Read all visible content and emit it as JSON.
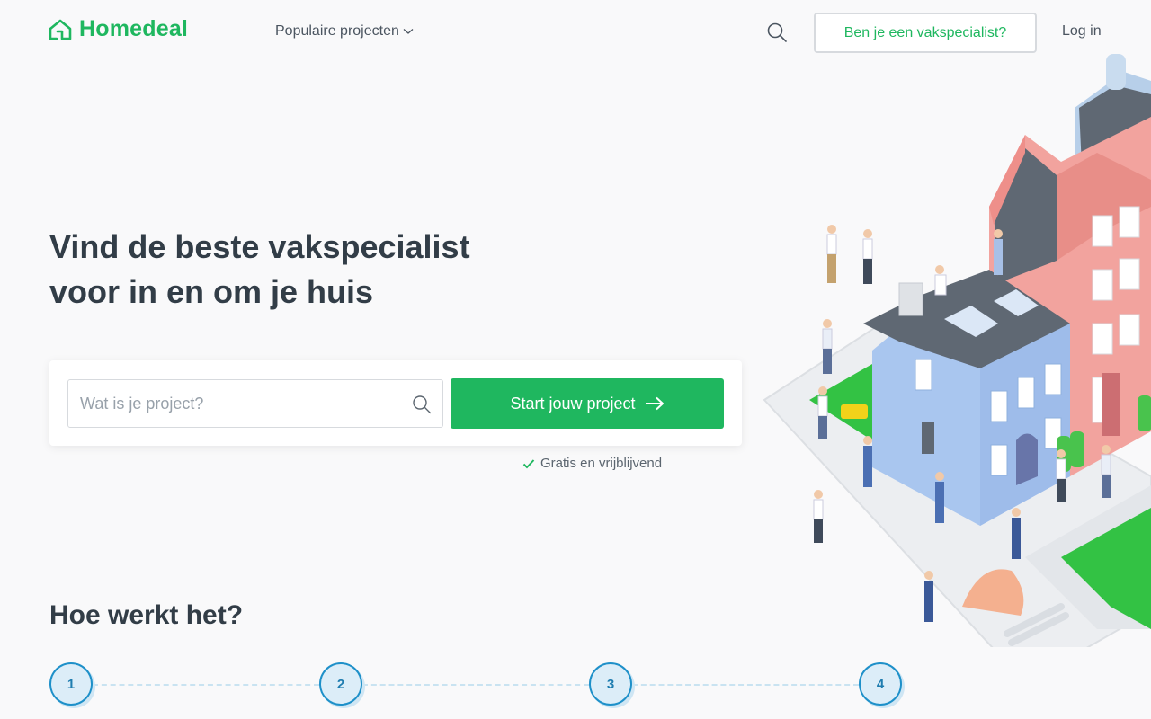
{
  "header": {
    "logo_text": "Homedeal",
    "nav_popular": "Populaire projecten",
    "pro_button": "Ben je een vakspecialist?",
    "login": "Log in"
  },
  "hero": {
    "title_line1": "Vind de beste vakspecialist",
    "title_line2": "voor in en om je huis"
  },
  "search": {
    "placeholder": "Wat is je project?",
    "value": "",
    "button_label": "Start jouw project",
    "note": "Gratis en vrijblijvend"
  },
  "how": {
    "title": "Hoe werkt het?",
    "steps": [
      "1",
      "2",
      "3",
      "4"
    ]
  },
  "colors": {
    "brand_green": "#1fb75f",
    "step_blue": "#1e90c9",
    "text_dark": "#323d47"
  },
  "icons": {
    "logo": "house-icon",
    "search": "search-icon",
    "dropdown": "chevron-down-icon",
    "arrow": "arrow-right-icon",
    "check": "check-icon"
  }
}
